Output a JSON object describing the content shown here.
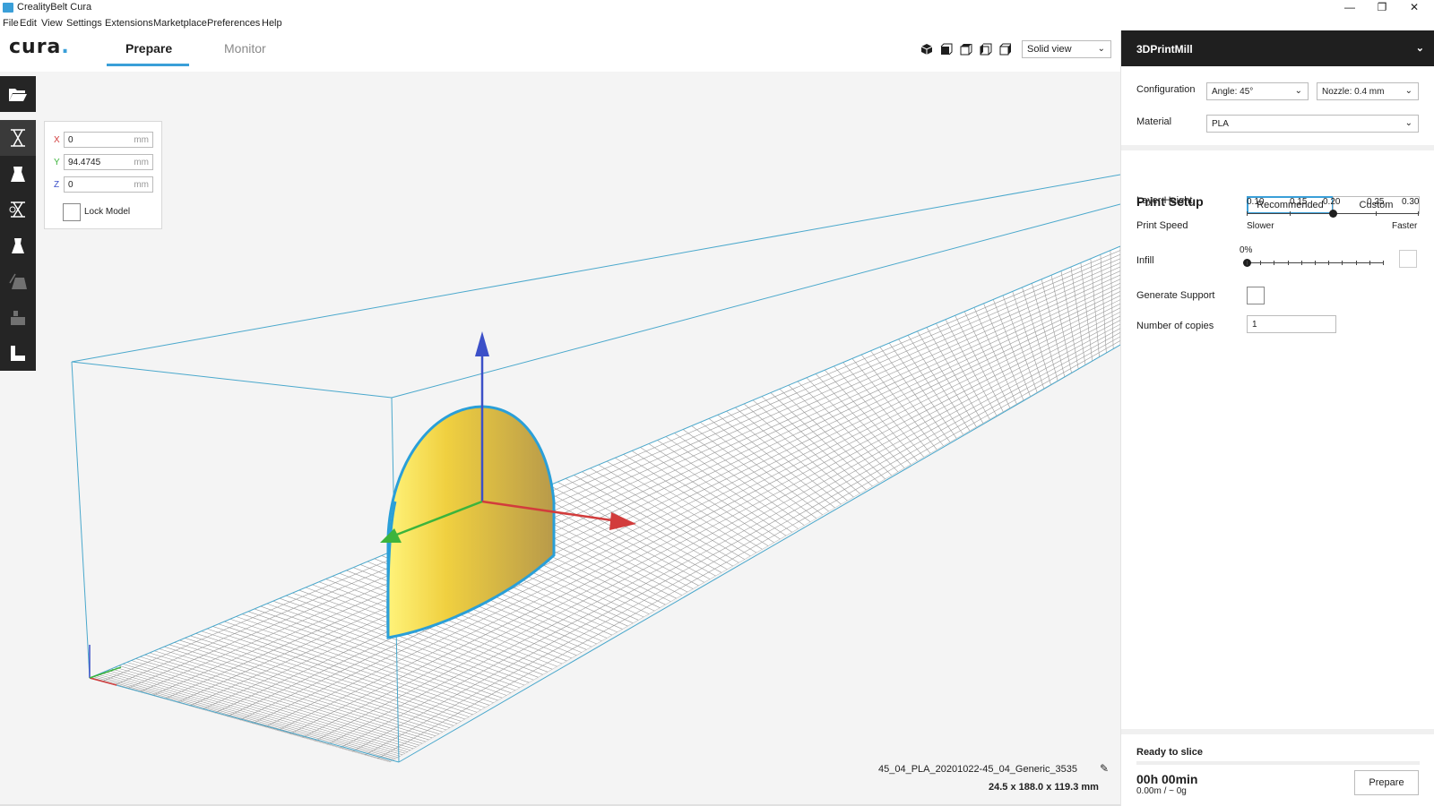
{
  "window": {
    "title": "CrealityBelt Cura",
    "controls": [
      "—",
      "❐",
      "✕"
    ]
  },
  "menubar": [
    "File",
    "Edit",
    "View",
    "Settings",
    "Extensions",
    "Marketplace",
    "Preferences",
    "Help"
  ],
  "header": {
    "logo": "cura",
    "logo_dot": ".",
    "tabs": [
      {
        "label": "Prepare",
        "active": true
      },
      {
        "label": "Monitor",
        "active": false
      }
    ],
    "view_mode": "Solid view",
    "view_icons": [
      "view-3d-icon",
      "view-front-icon",
      "view-top-icon",
      "view-left-icon",
      "view-right-icon"
    ]
  },
  "left_toolbar": {
    "tools": [
      "open-file-icon",
      "move-tool-icon",
      "scale-tool-icon",
      "rotate-tool-icon",
      "mirror-tool-icon",
      "per-model-settings-icon",
      "support-blocker-icon",
      "layflat-icon"
    ]
  },
  "move_panel": {
    "x": {
      "label": "X",
      "value": "0",
      "unit": "mm",
      "color": "#d23c3c"
    },
    "y": {
      "label": "Y",
      "value": "94.4745",
      "unit": "mm",
      "color": "#3cb43c"
    },
    "z": {
      "label": "Z",
      "value": "0",
      "unit": "mm",
      "color": "#3c50c8"
    },
    "lock_label": "Lock Model"
  },
  "right_panel": {
    "printer": "3DPrintMill",
    "configuration_label": "Configuration",
    "angle": "Angle: 45°",
    "nozzle": "Nozzle: 0.4 mm",
    "material_label": "Material",
    "material": "PLA",
    "print_setup": "Print Setup",
    "recommended": "Recommended",
    "custom": "Custom",
    "layer_height_label": "Layer Height",
    "layer_heights": [
      "0.10",
      "0.15",
      "0.20",
      "0.25",
      "0.30"
    ],
    "layer_height_selected": 0.2,
    "print_speed_label": "Print Speed",
    "slower": "Slower",
    "faster": "Faster",
    "infill_label": "Infill",
    "infill_value": "0%",
    "infill_percent": 0,
    "support_label": "Generate Support",
    "copies_label": "Number of copies",
    "copies": "1"
  },
  "slice": {
    "status": "Ready to slice",
    "time": "00h 00min",
    "cost": "0.00m / ~ 0g",
    "button": "Prepare"
  },
  "object": {
    "name": "45_04_PLA_20201022-45_04_Generic_3535",
    "dims": "24.5 x 188.0 x 119.3 mm"
  },
  "colors": {
    "accent": "#3a9fd8",
    "build_volume": "#4aa8cc",
    "model": "#f0d040",
    "axis_x": "#d23c3c",
    "axis_y": "#3cb43c",
    "axis_z": "#3c50c8"
  }
}
